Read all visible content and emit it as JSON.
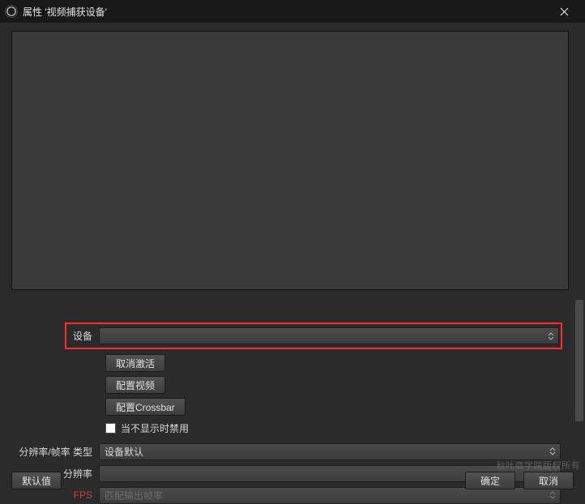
{
  "title": "属性 '视频捕获设备'",
  "form": {
    "device_label": "设备",
    "device_value": "",
    "deactivate_btn": "取消激活",
    "config_video_btn": "配置视频",
    "config_crossbar_btn": "配置Crossbar",
    "disable_when_hidden_label": "当不显示时禁用",
    "res_fps_type_label": "分辨率/帧率 类型",
    "res_fps_type_value": "设备默认",
    "resolution_label": "分辨率",
    "resolution_value": "",
    "fps_label": "FPS",
    "fps_value": "匹配输出帧率"
  },
  "footer": {
    "defaults": "默认值",
    "ok": "确定",
    "cancel": "取消"
  },
  "watermark": "秋叶商学院版权所有"
}
